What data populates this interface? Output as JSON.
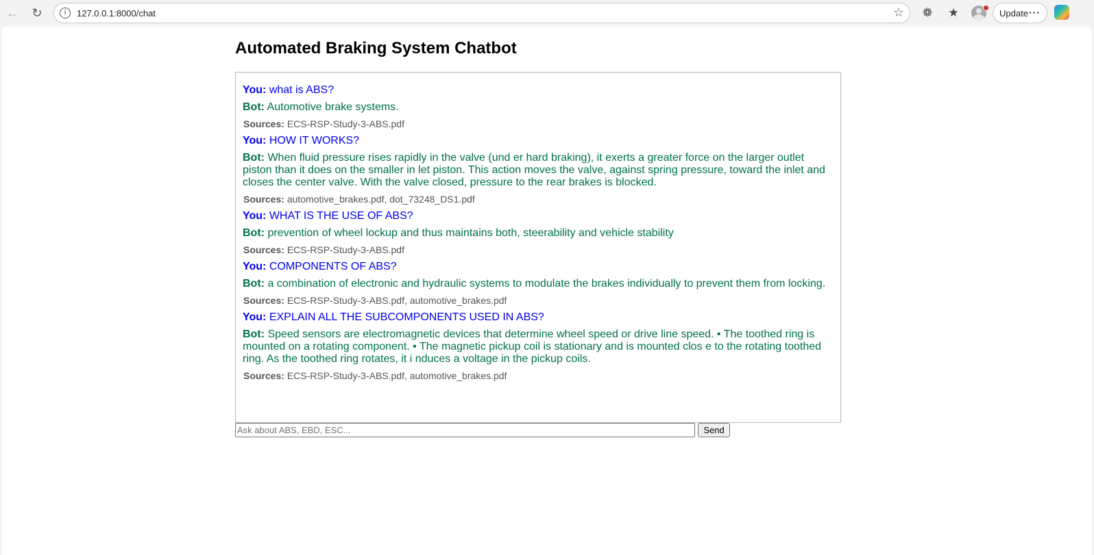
{
  "browser": {
    "url": "127.0.0.1:8000/chat",
    "update_label": "Update",
    "more_label": "···"
  },
  "page": {
    "title": "Automated Braking System Chatbot"
  },
  "labels": {
    "user": "You:",
    "bot": "Bot:",
    "sources": "Sources:"
  },
  "messages": [
    {
      "user": "what is ABS?",
      "bot": "Automotive brake systems.",
      "sources": "ECS-RSP-Study-3-ABS.pdf"
    },
    {
      "user": "HOW IT WORKS?",
      "bot": "When fluid pressure rises rapidly in the valve (und er hard braking), it exerts a greater force on the larger outlet piston than it does on the smaller in let piston. This action moves the valve, against spring pressure, toward the inlet and closes the center valve. With the valve closed, pressure to the rear brakes is blocked.",
      "sources": "automotive_brakes.pdf, dot_73248_DS1.pdf"
    },
    {
      "user": "WHAT IS THE USE OF ABS?",
      "bot": "prevention of wheel lockup and thus maintains both, steerability and vehicle stability",
      "sources": "ECS-RSP-Study-3-ABS.pdf"
    },
    {
      "user": "COMPONENTS OF ABS?",
      "bot": "a combination of electronic and hydraulic systems to modulate the brakes individually to prevent them from locking.",
      "sources": "ECS-RSP-Study-3-ABS.pdf, automotive_brakes.pdf"
    },
    {
      "user": "EXPLAIN ALL THE SUBCOMPONENTS USED IN ABS?",
      "bot": "Speed sensors are electromagnetic devices that determine wheel speed or drive line speed. • The toothed ring is mounted on a rotating component. • The magnetic pickup coil is stationary and is mounted clos e to the rotating toothed ring. As the toothed ring rotates, it i nduces a voltage in the pickup coils.",
      "sources": "ECS-RSP-Study-3-ABS.pdf, automotive_brakes.pdf"
    }
  ],
  "input": {
    "placeholder": "Ask about ABS, EBD, ESC...",
    "value": ""
  },
  "send_label": "Send",
  "colors": {
    "user_text": "#0000ee",
    "bot_text": "#007050",
    "sources_text": "#555555"
  }
}
